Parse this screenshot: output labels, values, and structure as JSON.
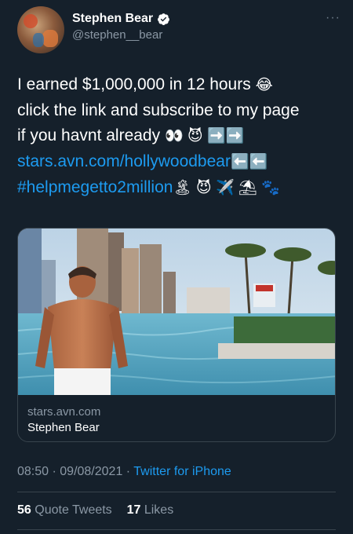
{
  "author": {
    "display_name": "Stephen Bear",
    "handle": "@stephen__bear"
  },
  "more_label": "···",
  "tweet": {
    "line1": "I earned $1,000,000 in 12 hours ",
    "line1_emoji": "😂",
    "line2": "click the link and subscribe to my page",
    "line3": "if you havnt already ",
    "line3_emoji": "👀 😈 ➡️➡️",
    "link": "stars.avn.com/hollywoodbear",
    "link_emoji": " ⬅️⬅️",
    "hashtag": "#helpmegetto2million",
    "hashtag_emoji": " 🏝 😈 ✈️ ⛱ 🐾"
  },
  "card": {
    "domain": "stars.avn.com",
    "title": "Stephen Bear",
    "sign_text": "DANGER"
  },
  "meta": {
    "time": "08:50",
    "sep1": " · ",
    "date": "09/08/2021",
    "sep2": " · ",
    "source": "Twitter for iPhone"
  },
  "stats": {
    "quote_count": "56",
    "quote_label": "Quote Tweets",
    "like_count": "17",
    "like_label": "Likes"
  },
  "colors": {
    "background": "#15202b",
    "link": "#1d9bf0",
    "secondary_text": "#8b98a5",
    "divider": "#38444d"
  }
}
